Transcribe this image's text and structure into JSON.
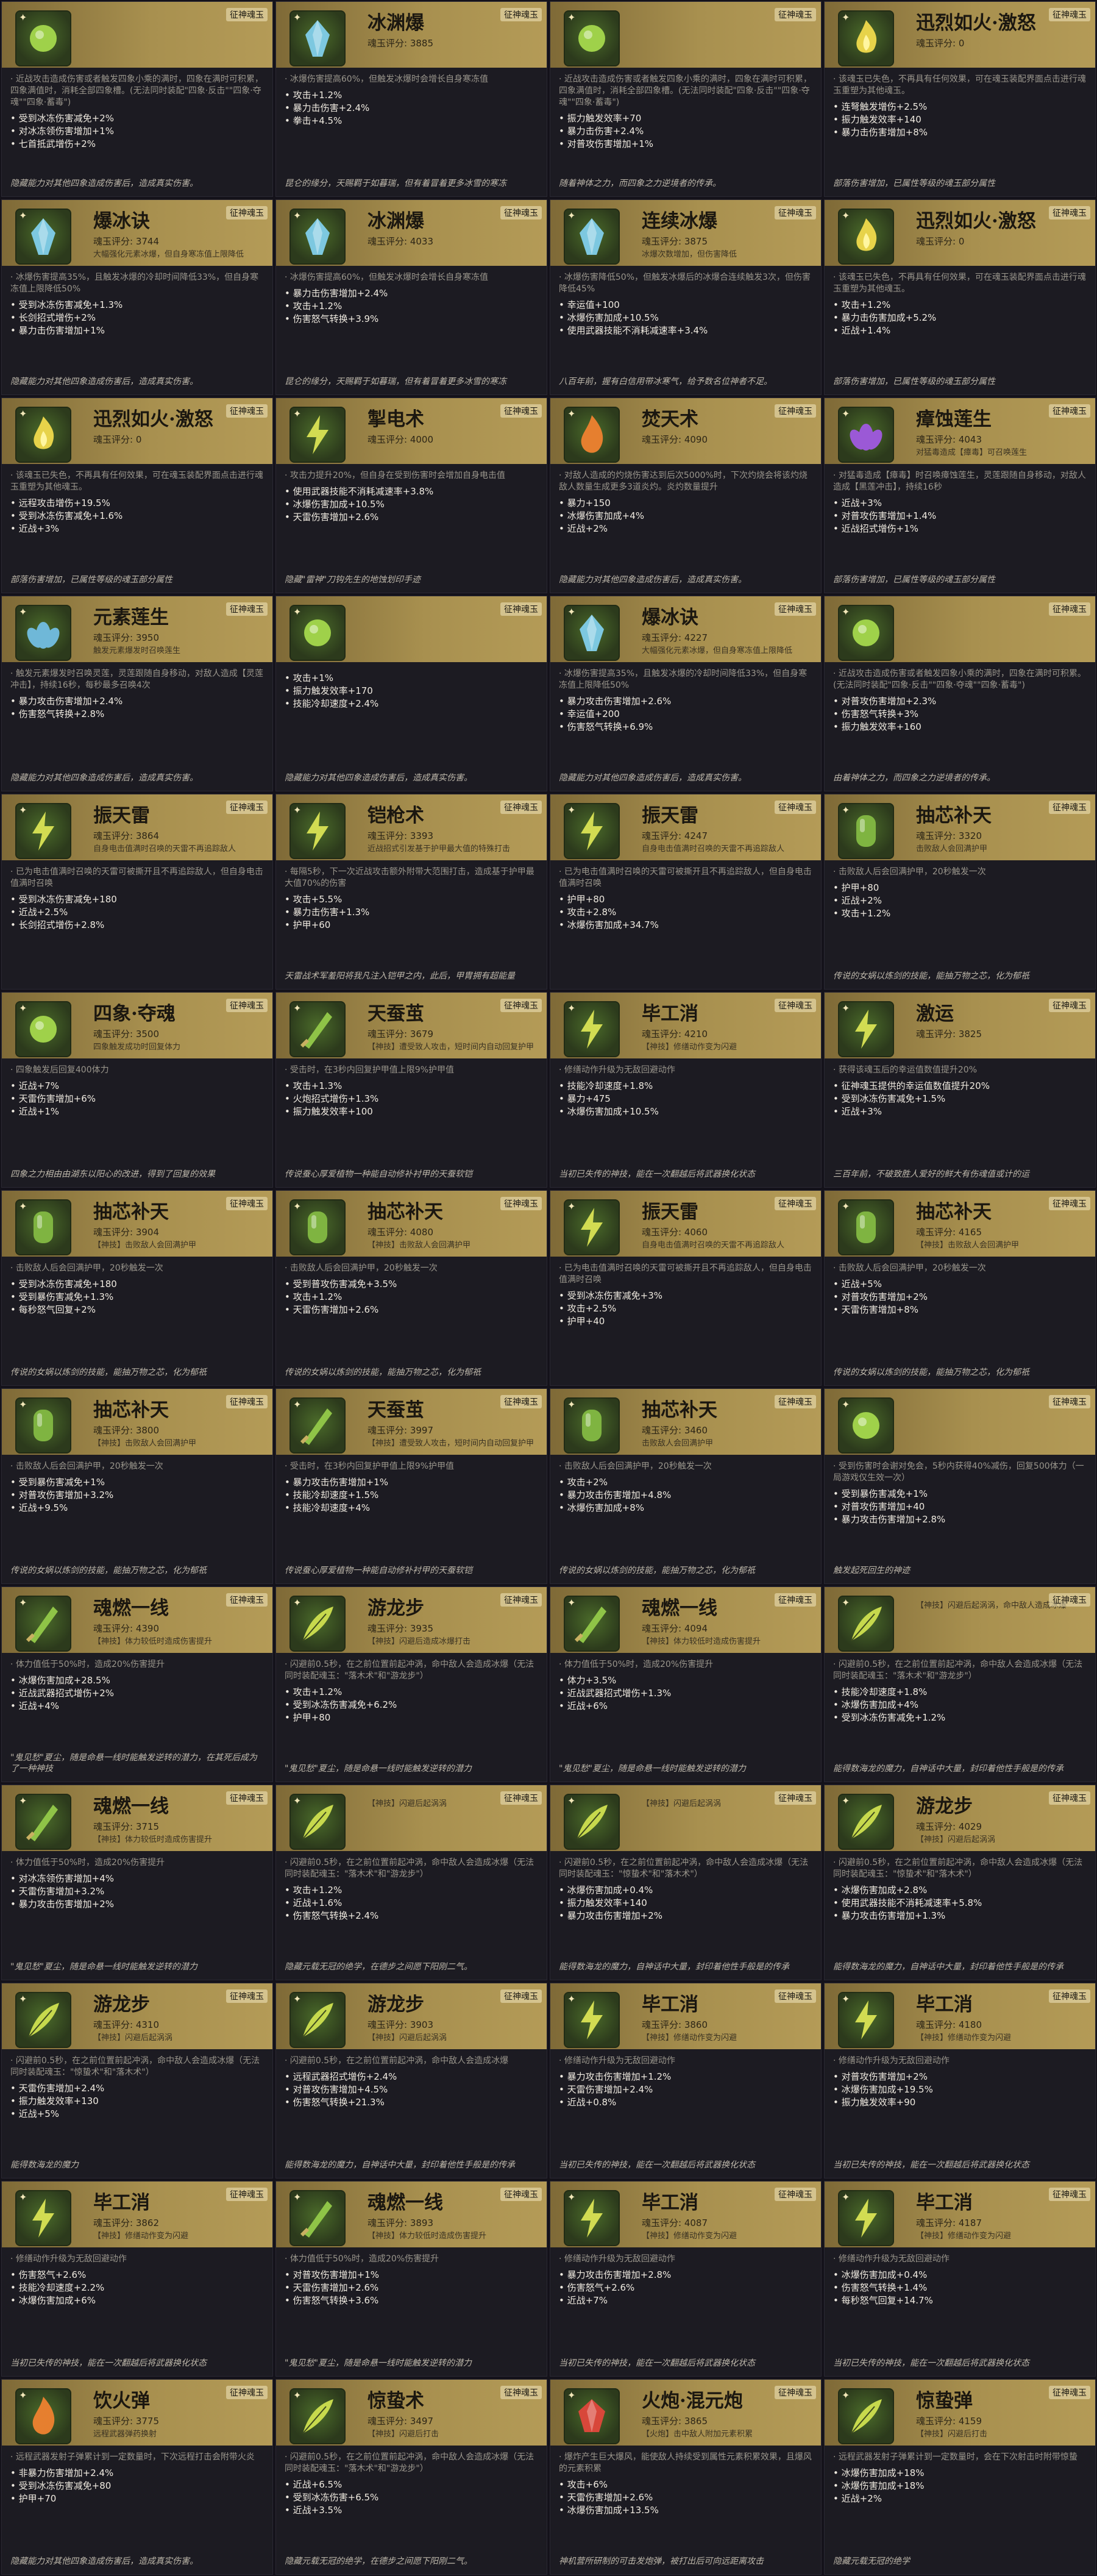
{
  "tag_label": "征神魂玉",
  "cards": [
    {
      "name": "",
      "score": "",
      "desc": "",
      "lead": "· 近战攻击造成伤害或者触发四象小乘的满时，四象在满时可积累，四象满值时，消耗全部四象槽。(无法同时装配\"四象·反击\"\"四象·夺魂\"\"四象·蓄毒\")",
      "stats": [
        "受到冰冻伤害减免+2%",
        "对冰冻领伤害增加+1%",
        "七首抵武增伤+2%"
      ],
      "foot": "隐藏能力对其他四象造成伤害后，造成真实伤害。",
      "icon": "orb",
      "color": "#9fd14a"
    },
    {
      "name": "冰渊爆",
      "score": "魂玉评分: 3885",
      "desc": "",
      "lead": "· 冰爆伤害提高60%，但触发冰爆时会增长自身寒冻值",
      "stats": [
        "攻击+1.2%",
        "暴力击伤害+2.4%",
        "拳击+4.5%"
      ],
      "foot": "昆仑的缘分，天赐羁于如暮瑞，但有着冒着更多冰雪的寒冻",
      "icon": "crystal",
      "color": "#7dc8e0"
    },
    {
      "name": "",
      "score": "",
      "desc": "",
      "lead": "· 近战攻击造成伤害或者触发四象小乘的满时，四象在满时可积累，四象满值时，消耗全部四象槽。(无法同时装配\"四象·反击\"\"四象·夺魂\"\"四象·蓄毒\")",
      "stats": [
        "振力触发效率+70",
        "暴力击伤害+2.4%",
        "对普攻伤害增加+1%"
      ],
      "foot": "随着神体之力，而四象之力逆境者的传承。",
      "icon": "orb",
      "color": "#9fd14a"
    },
    {
      "name": "迅烈如火·激怒",
      "score": "魂玉评分: 0",
      "desc": "",
      "lead": "· 该魂玉已失色，不再具有任何效果，可在魂玉装配界面点击进行魂玉重塑为其他魂玉。",
      "stats": [
        "连弩触发增伤+2.5%",
        "振力触发效率+140",
        "暴力击伤害增加+8%"
      ],
      "foot": "部落伤害增加，已属性等级的魂玉部分属性",
      "icon": "fire",
      "color": "#e7d34a"
    },
    {
      "name": "爆冰诀",
      "score": "魂玉评分: 3744",
      "desc": "大幅强化元素冰爆，但自身寒冻值上限降低",
      "lead": "· 冰爆伤害提高35%，且触发冰爆的冷却时间降低33%，但自身寒冻值上限降低50%",
      "stats": [
        "受到冰冻伤害减免+1.3%",
        "长剑招式增伤+2%",
        "暴力击伤害增加+1%"
      ],
      "foot": "隐藏能力对其他四象造成伤害后，造成真实伤害。",
      "icon": "crystal",
      "color": "#7dc8e0"
    },
    {
      "name": "冰渊爆",
      "score": "魂玉评分: 4033",
      "desc": "",
      "lead": "· 冰爆伤害提高60%，但触发冰爆时会增长自身寒冻值",
      "stats": [
        "暴力击伤害增加+2.4%",
        "攻击+1.2%",
        "伤害怒气转换+3.9%"
      ],
      "foot": "昆仑的缘分，天赐羁于如暮瑞，但有着冒着更多冰雪的寒冻",
      "icon": "crystal",
      "color": "#7dc8e0"
    },
    {
      "name": "连续冰爆",
      "score": "魂玉评分: 3875",
      "desc": "冰爆次数增加，但伤害降低",
      "lead": "· 冰爆伤害降低50%，但触发冰爆后的冰爆合连续触发3次，但伤害降低45%",
      "stats": [
        "幸运值+100",
        "冰爆伤害加成+10.5%",
        "使用武器技能不消耗减速率+3.4%"
      ],
      "foot": "八百年前，握有白信用带冰寒气，给予数名位神者不足。",
      "icon": "crystal",
      "color": "#7dc8e0"
    },
    {
      "name": "迅烈如火·激怒",
      "score": "魂玉评分: 0",
      "desc": "",
      "lead": "· 该魂玉已失色，不再具有任何效果，可在魂玉装配界面点击进行魂玉重塑为其他魂玉。",
      "stats": [
        "攻击+1.2%",
        "暴力击伤害加成+5.2%",
        "近战+1.4%"
      ],
      "foot": "部落伤害增加，已属性等级的魂玉部分属性",
      "icon": "fire",
      "color": "#e7d34a"
    },
    {
      "name": "迅烈如火·激怒",
      "score": "魂玉评分: 0",
      "desc": "",
      "lead": "· 该魂玉已失色，不再具有任何效果，可在魂玉装配界面点击进行魂玉重塑为其他魂玉。",
      "stats": [
        "远程攻击增伤+19.5%",
        "受到冰冻伤害减免+1.6%",
        "近战+3%"
      ],
      "foot": "部落伤害增加，已属性等级的魂玉部分属性",
      "icon": "fire",
      "color": "#e7d34a"
    },
    {
      "name": "掣电术",
      "score": "魂玉评分: 4000",
      "desc": "",
      "lead": "· 攻击力提升20%，但自身在受到伤害时会增加自身电击值",
      "stats": [
        "使用武器技能不消耗减速率+3.8%",
        "冰爆伤害加成+10.5%",
        "天雷伤害增加+2.6%"
      ],
      "foot": "隐藏\"雷神\"刀钩先生的地蚀划印手迹",
      "icon": "bolt",
      "color": "#d2dc52"
    },
    {
      "name": "焚天术",
      "score": "魂玉评分: 4090",
      "desc": "",
      "lead": "· 对敌人造成的灼烧伤害达到后次5000%时，下次灼烧会将该灼烧敌人数量生成更多3道炎灼。炎灼数量提升",
      "stats": [
        "暴力+150",
        "冰爆伤害加成+4%",
        "近战+2%"
      ],
      "foot": "隐藏能力对其他四象造成伤害后，造成真实伤害。",
      "icon": "flame",
      "color": "#e67f2f"
    },
    {
      "name": "瘴蚀莲生",
      "score": "魂玉评分: 4043",
      "desc": "对猛毒造成【瘴毒】可召唤莲生",
      "lead": "· 对猛毒造成【瘴毒】时召唤瘴蚀莲生，灵莲跟随自身移动，对敌人造成【黑莲冲击】，持续16秒",
      "stats": [
        "近战+3%",
        "对普攻伤害增加+1.4%",
        "近战招式增伤+1%"
      ],
      "foot": "部落伤害增加，已属性等级的魂玉部分属性",
      "icon": "lotus",
      "color": "#9b59d6"
    },
    {
      "name": "元素莲生",
      "score": "魂玉评分: 3950",
      "desc": "触发元素爆发时召唤莲生",
      "lead": "· 触发元素爆发时召唤灵莲，灵莲跟随自身移动，对敌人造成【灵莲冲击】，持续16秒，每秒最多召唤4次",
      "stats": [
        "暴力攻击伤害增加+2.4%",
        "伤害怒气转换+2.8%"
      ],
      "foot": "隐藏能力对其他四象造成伤害后，造成真实伤害。",
      "icon": "lotus",
      "color": "#6fb8d8"
    },
    {
      "name": "",
      "score": "",
      "desc": "",
      "lead": "",
      "stats": [
        "攻击+1%",
        "振力触发效率+170",
        "技能冷却速度+2.4%"
      ],
      "foot": "隐藏能力对其他四象造成伤害后，造成真实伤害。",
      "icon": "orb",
      "color": "#9fd14a"
    },
    {
      "name": "爆冰诀",
      "score": "魂玉评分: 4227",
      "desc": "大幅强化元素冰爆，但自身寒冻值上限降低",
      "lead": "· 冰爆伤害提高35%，且触发冰爆的冷却时间降低33%，但自身寒冻值上限降低50%",
      "stats": [
        "暴力攻击伤害增加+2.6%",
        "幸运值+200",
        "伤害怒气转换+6.9%"
      ],
      "foot": "隐藏能力对其他四象造成伤害后，造成真实伤害。",
      "icon": "crystal",
      "color": "#7dc8e0"
    },
    {
      "name": "",
      "score": "",
      "desc": "",
      "lead": "· 近战攻击造成伤害或者触发四象小乘的满时，四象在满时可积累。(无法同时装配\"四象·反击\"\"四象·夺魂\"\"四象·蓄毒\")",
      "stats": [
        "对普攻伤害增加+2.3%",
        "伤害怒气转换+3%",
        "振力触发效率+160"
      ],
      "foot": "由着神体之力，而四象之力逆境者的传承。",
      "icon": "orb",
      "color": "#9fd14a"
    },
    {
      "name": "振天雷",
      "score": "魂玉评分: 3864",
      "desc": "自身电击值满时召唤的天雷不再追踪敌人",
      "lead": "· 已为电击值满时召唤的天雷可被撕开且不再追踪敌人，但自身电击值满时召唤",
      "stats": [
        "受到冰冻伤害减免+180",
        "近战+2.5%",
        "长剑招式增伤+2.8%"
      ],
      "foot": "",
      "icon": "bolt",
      "color": "#d2dc52"
    },
    {
      "name": "铠枪术",
      "score": "魂玉评分: 3393",
      "desc": "近战招式引发基于护甲最大值的特殊打击",
      "lead": "· 每隔5秒，下一次近战攻击额外附带大范围打击，造成基于护甲最大值70%的伤害",
      "stats": [
        "攻击+5.5%",
        "暴力击伤害+1.3%",
        "护甲+60"
      ],
      "foot": "天雷战术军羞阳将我凡注入铠甲之内，此后，甲胄拥有超能量",
      "icon": "bolt",
      "color": "#d2dc52"
    },
    {
      "name": "振天雷",
      "score": "魂玉评分: 4247",
      "desc": "自身电击值满时召唤的天雷不再追踪敌人",
      "lead": "· 已为电击值满时召唤的天雷可被撕开且不再追踪敌人，但自身电击值满时召唤",
      "stats": [
        "护甲+80",
        "攻击+2.8%",
        "冰爆伤害加成+34.7%"
      ],
      "foot": "",
      "icon": "bolt",
      "color": "#d2dc52"
    },
    {
      "name": "抽芯补天",
      "score": "魂玉评分: 3320",
      "desc": "击败敌人会回满护甲",
      "lead": "· 击败敌人后会回满护甲，20秒触发一次",
      "stats": [
        "护甲+80",
        "近战+2%",
        "攻击+1.2%"
      ],
      "foot": "传说的女娲以炼剑的技能，能抽万物之芯，化为郁祇",
      "icon": "pill",
      "color": "#7fb441"
    },
    {
      "name": "四象·夺魂",
      "score": "魂玉评分: 3500",
      "desc": "四象触发成功时回复体力",
      "lead": "· 四象触发后回复400体力",
      "stats": [
        "近战+7%",
        "天雷伤害增加+6%",
        "近战+1%"
      ],
      "foot": "四象之力相由由湖东以阳心的改进，得到了回复的效果",
      "icon": "orb",
      "color": "#9fd14a"
    },
    {
      "name": "天蚕茧",
      "score": "魂玉评分: 3679",
      "desc": "【神技】遭受致人攻击，短时间内自动回复护甲",
      "lead": "· 受击时，在3秒内回复护甲值上限9%护甲值",
      "stats": [
        "攻击+1.3%",
        "火炮招式增伤+1.3%",
        "振力触发效率+100"
      ],
      "foot": "传说蚕心厚爱植物一种能自动修补衬甲的天蚕软铠",
      "icon": "blade",
      "color": "#8fc447"
    },
    {
      "name": "毕工消",
      "score": "魂玉评分: 4210",
      "desc": "【神技】修缮动作变为闪避",
      "lead": "· 修缮动作升级为无敌回避动作",
      "stats": [
        "技能冷却速度+1.8%",
        "暴力+475",
        "冰爆伤害加成+10.5%"
      ],
      "foot": "当初已失传的神技，能在一次翻越后将武器换化状态",
      "icon": "bolt",
      "color": "#d2dc52"
    },
    {
      "name": "激运",
      "score": "魂玉评分: 3825",
      "desc": "",
      "lead": "· 获得该魂玉后的幸运值数值提升20%",
      "stats": [
        "征神魂玉提供的幸运值数值提升20%",
        "受到冰冻伤害减免+1.5%",
        "近战+3%"
      ],
      "foot": "三百年前，不破致胜人爱好的鲜大有伤魂值或计的运",
      "icon": "bolt",
      "color": "#d2dc52"
    },
    {
      "name": "抽芯补天",
      "score": "魂玉评分: 3904",
      "desc": "【神技】击败敌人会回满护甲",
      "lead": "· 击败敌人后会回满护甲，20秒触发一次",
      "stats": [
        "受到冰冻伤害减免+180",
        "受到暴伤害减免+1.3%",
        "每秒怒气回复+2%"
      ],
      "foot": "传说的女娲以炼剑的技能，能抽万物之芯，化为郁祇",
      "icon": "pill",
      "color": "#7fb441"
    },
    {
      "name": "抽芯补天",
      "score": "魂玉评分: 4080",
      "desc": "【神技】击败敌人会回满护甲",
      "lead": "· 击败敌人后会回满护甲，20秒触发一次",
      "stats": [
        "受到普攻伤害减免+3.5%",
        "攻击+1.2%",
        "天雷伤害增加+2.6%"
      ],
      "foot": "传说的女娲以炼剑的技能，能抽万物之芯，化为郁祇",
      "icon": "pill",
      "color": "#7fb441"
    },
    {
      "name": "振天雷",
      "score": "魂玉评分: 4060",
      "desc": "自身电击值满时召唤的天雷不再追踪敌人",
      "lead": "· 已为电击值满时召唤的天雷可被撕开且不再追踪敌人，但自身电击值满时召唤",
      "stats": [
        "受到冰冻伤害减免+3%",
        "攻击+2.5%",
        "护甲+40"
      ],
      "foot": "",
      "icon": "bolt",
      "color": "#d2dc52"
    },
    {
      "name": "抽芯补天",
      "score": "魂玉评分: 4165",
      "desc": "【神技】击败敌人会回满护甲",
      "lead": "· 击败敌人后会回满护甲，20秒触发一次",
      "stats": [
        "近战+5%",
        "对普攻伤害增加+2%",
        "天雷伤害增加+8%"
      ],
      "foot": "传说的女娲以炼剑的技能，能抽万物之芯，化为郁祇",
      "icon": "pill",
      "color": "#7fb441"
    },
    {
      "name": "抽芯补天",
      "score": "魂玉评分: 3800",
      "desc": "【神技】击败敌人会回满护甲",
      "lead": "· 击败敌人后会回满护甲，20秒触发一次",
      "stats": [
        "受到暴伤害减免+1%",
        "对普攻伤害增加+3.2%",
        "近战+9.5%"
      ],
      "foot": "传说的女娲以炼剑的技能，能抽万物之芯，化为郁祇",
      "icon": "pill",
      "color": "#7fb441"
    },
    {
      "name": "天蚕茧",
      "score": "魂玉评分: 3997",
      "desc": "【神技】遭受致人攻击，短时间内自动回复护甲",
      "lead": "· 受击时，在3秒内回复护甲值上限9%护甲值",
      "stats": [
        "暴力攻击伤害增加+1%",
        "技能冷却速度+1.5%",
        "技能冷却速度+4%"
      ],
      "foot": "传说蚕心厚爱植物一种能自动修补衬甲的天蚕软铠",
      "icon": "blade",
      "color": "#8fc447"
    },
    {
      "name": "抽芯补天",
      "score": "魂玉评分: 3460",
      "desc": "击败敌人会回满护甲",
      "lead": "· 击败敌人后会回满护甲，20秒触发一次",
      "stats": [
        "攻击+2%",
        "暴力攻击伤害增加+4.8%",
        "冰爆伤害加成+8%"
      ],
      "foot": "传说的女娲以炼剑的技能，能抽万物之芯，化为郁祇",
      "icon": "pill",
      "color": "#7fb441"
    },
    {
      "name": "",
      "score": "",
      "desc": "",
      "lead": "· 受到伤害时会谢对免会，5秒内获得40%减伤，回复500体力（一局游戏仅生效一次）",
      "stats": [
        "受到暴伤害减免+1%",
        "对普攻伤害增加+40",
        "暴力攻击伤害增加+2.8%"
      ],
      "foot": "触发起死回生的神迹",
      "icon": "orb",
      "color": "#9fd14a"
    },
    {
      "name": "魂燃一线",
      "score": "魂玉评分: 4390",
      "desc": "【神技】体力较低时造成伤害提升",
      "lead": "· 体力值低于50%时，造成20%伤害提升",
      "stats": [
        "冰爆伤害加成+28.5%",
        "近战武器招式增伤+2%",
        "近战+4%"
      ],
      "foot": "\"鬼见愁\"夏尘，随是命悬一线时能触发逆转的潜力，在其死后成为了一种神技",
      "icon": "blade",
      "color": "#8fc447"
    },
    {
      "name": "游龙步",
      "score": "魂玉评分: 3935",
      "desc": "【神技】闪避后造成冰爆打击",
      "lead": "· 闪避前0.5秒，在之前位置前起冲涡，命中敌人会造成冰爆（无法同时装配魂玉：\"落木术\"和\"游龙步\"）",
      "stats": [
        "攻击+1.2%",
        "受到冰冻伤害减免+6.2%",
        "护甲+80"
      ],
      "foot": "\"鬼见愁\"夏尘，随是命悬一线时能触发逆转的潜力",
      "icon": "feather",
      "color": "#c7d94d"
    },
    {
      "name": "魂燃一线",
      "score": "魂玉评分: 4094",
      "desc": "【神技】体力较低时造成伤害提升",
      "lead": "· 体力值低于50%时，造成20%伤害提升",
      "stats": [
        "体力+3.5%",
        "近战武器招式增伤+1.3%",
        "近战+6%"
      ],
      "foot": "\"鬼见愁\"夏尘，随是命悬一线时能触发逆转的潜力",
      "icon": "blade",
      "color": "#8fc447"
    },
    {
      "name": "",
      "score": "",
      "desc": "【神技】闪避后起涡涡，命中敌人造成冰爆",
      "lead": "· 闪避前0.5秒，在之前位置前起冲涡，命中敌人会造成冰爆（无法同时装配魂玉：\"落木术\"和\"游龙步\"）",
      "stats": [
        "技能冷却速度+1.8%",
        "冰爆伤害加成+4%",
        "受到冰冻伤害减免+1.2%"
      ],
      "foot": "能得数海龙的魔力，自神话中大量，封印着他性手般是的传承",
      "icon": "feather",
      "color": "#c7d94d"
    },
    {
      "name": "魂燃一线",
      "score": "魂玉评分: 3715",
      "desc": "【神技】体力较低时造成伤害提升",
      "lead": "· 体力值低于50%时，造成20%伤害提升",
      "stats": [
        "对冰冻领伤害增加+4%",
        "天雷伤害增加+3.2%",
        "暴力攻击伤害增加+2%"
      ],
      "foot": "\"鬼见愁\"夏尘，随是命悬一线时能触发逆转的潜力",
      "icon": "blade",
      "color": "#8fc447"
    },
    {
      "name": "",
      "score": "",
      "desc": "【神技】闪避后起涡涡",
      "lead": "· 闪避前0.5秒，在之前位置前起冲涡，命中敌人会造成冰爆（无法同时装配魂玉：\"落木术\"和\"游龙步\"）",
      "stats": [
        "攻击+1.2%",
        "近战+1.6%",
        "伤害怒气转换+2.4%"
      ],
      "foot": "隐藏元载无冠的绝学，在德步之间愿下阳刚二气。",
      "icon": "feather",
      "color": "#c7d94d"
    },
    {
      "name": "",
      "score": "",
      "desc": "【神技】闪避后起涡涡",
      "lead": "· 闪避前0.5秒，在之前位置前起冲涡，命中敌人会造成冰爆（无法同时装配魂玉：\"惊蛰术\"和\"落木术\"）",
      "stats": [
        "冰爆伤害加成+0.4%",
        "振力触发效率+140",
        "暴力攻击伤害增加+2%"
      ],
      "foot": "能得数海龙的魔力，自神话中大量，封印着他性手般是的传承",
      "icon": "feather",
      "color": "#c7d94d"
    },
    {
      "name": "游龙步",
      "score": "魂玉评分: 4029",
      "desc": "【神技】闪避后起涡涡",
      "lead": "· 闪避前0.5秒，在之前位置前起冲涡，命中敌人会造成冰爆（无法同时装配魂玉：\"惊蛰术\"和\"落木术\"）",
      "stats": [
        "冰爆伤害加成+2.8%",
        "使用武器技能不消耗减速率+5.8%",
        "暴力攻击伤害增加+1.3%"
      ],
      "foot": "能得数海龙的魔力，自神话中大量，封印着他性手般是的传承",
      "icon": "feather",
      "color": "#c7d94d"
    },
    {
      "name": "游龙步",
      "score": "魂玉评分: 4310",
      "desc": "【神技】闪避后起涡涡",
      "lead": "· 闪避前0.5秒，在之前位置前起冲涡，命中敌人会造成冰爆（无法同时装配魂玉：\"惊蛰术\"和\"落木术\"）",
      "stats": [
        "天雷伤害增加+2.4%",
        "振力触发效率+130",
        "近战+5%"
      ],
      "foot": "能得数海龙的魔力",
      "icon": "feather",
      "color": "#c7d94d"
    },
    {
      "name": "游龙步",
      "score": "魂玉评分: 3903",
      "desc": "【神技】闪避后起涡涡",
      "lead": "· 闪避前0.5秒，在之前位置前起冲涡，命中敌人会造成冰爆",
      "stats": [
        "远程武器招式增伤+2.4%",
        "对普攻伤害增加+4.5%",
        "伤害怒气转换+21.3%"
      ],
      "foot": "能得数海龙的魔力，自神话中大量，封印着他性手般是的传承",
      "icon": "feather",
      "color": "#c7d94d"
    },
    {
      "name": "毕工消",
      "score": "魂玉评分: 3860",
      "desc": "【神技】修缮动作变为闪避",
      "lead": "· 修缮动作升级为无敌回避动作",
      "stats": [
        "暴力攻击伤害增加+1.2%",
        "天雷伤害增加+2.4%",
        "近战+0.8%"
      ],
      "foot": "当初已失传的神技，能在一次翻越后将武器换化状态",
      "icon": "bolt",
      "color": "#d2dc52"
    },
    {
      "name": "毕工消",
      "score": "魂玉评分: 4180",
      "desc": "【神技】修缮动作变为闪避",
      "lead": "· 修缮动作升级为无敌回避动作",
      "stats": [
        "对普攻伤害增加+2%",
        "冰爆伤害加成+19.5%",
        "振力触发效率+90"
      ],
      "foot": "当初已失传的神技，能在一次翻越后将武器换化状态",
      "icon": "bolt",
      "color": "#d2dc52"
    },
    {
      "name": "毕工消",
      "score": "魂玉评分: 3862",
      "desc": "【神技】修缮动作变为闪避",
      "lead": "· 修缮动作升级为无敌回避动作",
      "stats": [
        "伤害怒气+2.6%",
        "技能冷却速度+2.2%",
        "冰爆伤害加成+6%"
      ],
      "foot": "当初已失传的神技，能在一次翻越后将武器换化状态",
      "icon": "bolt",
      "color": "#d2dc52"
    },
    {
      "name": "魂燃一线",
      "score": "魂玉评分: 3893",
      "desc": "【神技】体力较低时造成伤害提升",
      "lead": "· 体力值低于50%时，造成20%伤害提升",
      "stats": [
        "对普攻伤害增加+1%",
        "天雷伤害增加+2.6%",
        "伤害怒气转换+3.6%"
      ],
      "foot": "\"鬼见愁\"夏尘，随是命悬一线时能触发逆转的潜力",
      "icon": "blade",
      "color": "#8fc447"
    },
    {
      "name": "毕工消",
      "score": "魂玉评分: 4087",
      "desc": "【神技】修缮动作变为闪避",
      "lead": "· 修缮动作升级为无敌回避动作",
      "stats": [
        "暴力攻击伤害增加+2.8%",
        "伤害怒气+2.6%",
        "近战+7%"
      ],
      "foot": "当初已失传的神技，能在一次翻越后将武器换化状态",
      "icon": "bolt",
      "color": "#d2dc52"
    },
    {
      "name": "毕工消",
      "score": "魂玉评分: 4187",
      "desc": "【神技】修缮动作变为闪避",
      "lead": "· 修缮动作升级为无敌回避动作",
      "stats": [
        "冰爆伤害加成+0.4%",
        "伤害怒气转换+1.4%",
        "每秒怒气回复+14.7%"
      ],
      "foot": "当初已失传的神技，能在一次翻越后将武器换化状态",
      "icon": "bolt",
      "color": "#d2dc52"
    },
    {
      "name": "饮火弹",
      "score": "魂玉评分: 3775",
      "desc": "远程武器弹药换射",
      "lead": "· 远程武器发射子弹累计到一定数量时，下次远程打击会附带火炎",
      "stats": [
        "非暴力伤害增加+2.4%",
        "受到冰冻伤害减免+80",
        "护甲+70"
      ],
      "foot": "隐藏能力对其他四象造成伤害后，造成真实伤害。",
      "icon": "flame",
      "color": "#e67f2f"
    },
    {
      "name": "惊蛰术",
      "score": "魂玉评分: 3497",
      "desc": "【神技】闪避后打击",
      "lead": "· 闪避前0.5秒，在之前位置前起冲涡，命中敌人会造成冰爆（无法同时装配魂玉：\"落木术\"和\"游龙步\"）",
      "stats": [
        "近战+6.5%",
        "受到冰冻伤害+6.5%",
        "近战+3.5%"
      ],
      "foot": "隐藏元载无冠的绝学，在德步之间愿下阳刚二气。",
      "icon": "feather",
      "color": "#c7d94d"
    },
    {
      "name": "火炮·混元炮",
      "score": "魂玉评分: 3865",
      "desc": "【火炮】击中敌人附加元素积累",
      "lead": "· 爆炸产生巨大爆风，能使敌人持续受到属性元素积累效果，且爆风的元素积累",
      "stats": [
        "攻击+6%",
        "天雷伤害增加+2.6%",
        "冰爆伤害加成+13.5%"
      ],
      "foot": "神机营所研制的可击发炮弹，被打出后可向远距离攻击",
      "icon": "redgem",
      "color": "#d8473a"
    },
    {
      "name": "惊蛰弹",
      "score": "魂玉评分: 4159",
      "desc": "【神技】闪避后打击",
      "lead": "· 远程武器发射子弹累计到一定数量时，会在下次射击时附带惊蛰",
      "stats": [
        "冰爆伤害加成+18%",
        "冰爆伤害加成+18%",
        "近战+2%"
      ],
      "foot": "隐藏元载无冠的绝学",
      "icon": "feather",
      "color": "#c7d94d"
    }
  ]
}
